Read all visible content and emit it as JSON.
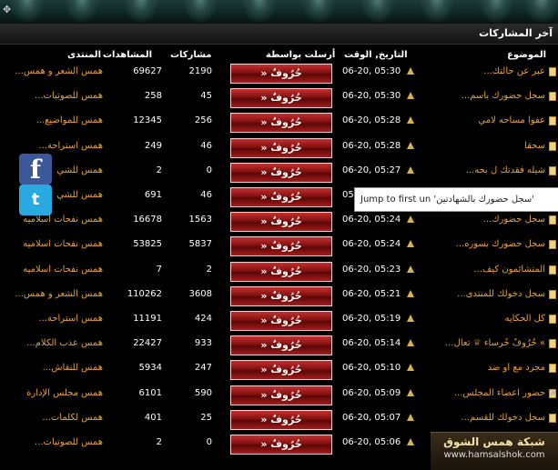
{
  "header": {
    "title": "آخر المشاركات"
  },
  "columns": {
    "topic": "الموضوع",
    "date": "التاريخ, الوقت",
    "poster": "أرسلت بواسطة",
    "posts": "مشاركات",
    "views": "المشاهدات",
    "forum": "المنتدى"
  },
  "rows": [
    {
      "topic": "عبر عن حالتك...",
      "date": "06-20, 05:30",
      "poster": "» حُرُوفٌ",
      "posts": "2190",
      "views": "69627",
      "forum": "همس الشعر و همس..."
    },
    {
      "topic": "سجل حضورك بأسم...",
      "date": "06-20, 05:30",
      "poster": "» حُرُوفٌ",
      "posts": "45",
      "views": "258",
      "forum": "همس للصوتيات..."
    },
    {
      "topic": "عفوا مساحه لامي",
      "date": "06-20, 05:28",
      "poster": "» حُرُوفٌ",
      "posts": "256",
      "views": "12345",
      "forum": "همس للمواضيع..."
    },
    {
      "topic": "سحقا",
      "date": "06-20, 05:28",
      "poster": "» حُرُوفٌ",
      "posts": "46",
      "views": "249",
      "forum": "همس استراحة..."
    },
    {
      "topic": "شيله فقدتك ل بحه...",
      "date": "06-20, 05:27",
      "poster": "» حُرُوفٌ",
      "posts": "0",
      "views": "2",
      "forum": "همس للشي"
    },
    {
      "topic": "",
      "date": "05",
      "poster": "» حُرُوفٌ",
      "posts": "46",
      "views": "691",
      "forum": "همس للشي"
    },
    {
      "topic": "سجل حضورك...",
      "date": "06-20, 05:24",
      "poster": "» حُرُوفٌ",
      "posts": "1563",
      "views": "16678",
      "forum": "همس نفحات اسلاميه"
    },
    {
      "topic": "سجل حضورك بسوره...",
      "date": "06-20, 05:24",
      "poster": "» حُرُوفٌ",
      "posts": "5837",
      "views": "53825",
      "forum": "همس نفحات اسلاميه"
    },
    {
      "topic": "المتشائمون كيف...",
      "date": "06-20, 05:23",
      "poster": "» حُرُوفٌ",
      "posts": "2",
      "views": "7",
      "forum": "همس نفحات اسلاميه"
    },
    {
      "topic": "سجل دخولك للمنتدى...",
      "date": "06-20, 05:21",
      "poster": "» حُرُوفٌ",
      "posts": "3608",
      "views": "110262",
      "forum": "همس الشعر و همس..."
    },
    {
      "topic": "كل الحكايه",
      "date": "06-20, 05:19",
      "poster": "» حُرُوفٌ",
      "posts": "424",
      "views": "11191",
      "forum": "همس استراحة..."
    },
    {
      "topic": "» حُرُوفٌ خُرساء ♕ تعال...",
      "date": "06-20, 05:14",
      "poster": "» حُرُوفٌ",
      "posts": "933",
      "views": "22427",
      "forum": "همس عذب الكلام..."
    },
    {
      "topic": "مجرد مع أو ضد",
      "date": "06-20, 05:10",
      "poster": "» حُرُوفٌ",
      "posts": "247",
      "views": "5934",
      "forum": "همس للنقاش..."
    },
    {
      "topic": "حضور اعضاء المجلس...",
      "date": "06-20, 05:09",
      "poster": "» حُرُوفٌ",
      "posts": "590",
      "views": "6101",
      "forum": "همس مجلس الإدارة"
    },
    {
      "topic": "سجل دخولك للقسم...",
      "date": "06-20, 05:07",
      "poster": "» حُرُوفٌ",
      "posts": "25",
      "views": "401",
      "forum": "همس لكلمات..."
    },
    {
      "topic": "",
      "date": "06-20, 05:06",
      "poster": "» حُرُوفٌ",
      "posts": "0",
      "views": "2",
      "forum": "همس للصوتيات..."
    }
  ],
  "tooltip": {
    "text": "Jump to first un 'سجل حضورك بالشهادتين'"
  },
  "social": {
    "facebook": "f",
    "twitter": "t"
  },
  "watermark": {
    "title": "شبكة همس الشوق",
    "url": "www.hamsalshok.com"
  },
  "toolbar": {
    "move_glyph": "✥"
  },
  "scroll": {
    "up": "▲",
    "down": "▼"
  },
  "icons": {
    "topic": "document-icon",
    "arrow": "triangle-up-icon"
  },
  "colors": {
    "link": "#e8a23a",
    "poster_red": "#a51d1d",
    "facebook": "#3b5998",
    "twitter": "#29a9e1"
  }
}
